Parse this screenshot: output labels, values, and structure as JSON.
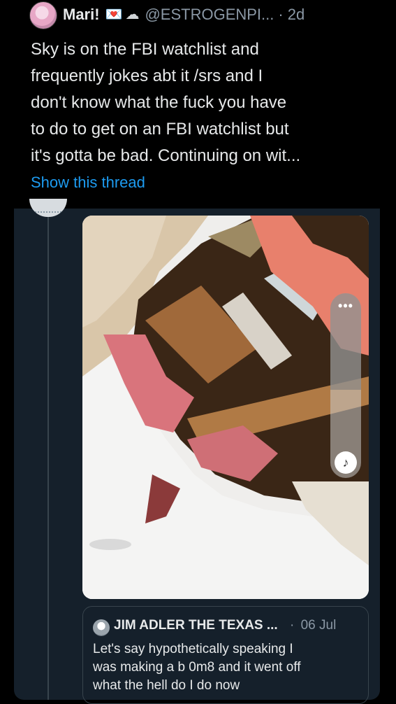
{
  "tweet": {
    "author_name": "Mari!",
    "emoji_1": "💌",
    "emoji_2": "☁",
    "handle": "@ESTROGENPI...",
    "separator": "·",
    "time": "2d",
    "text": "Sky is on the FBI watchlist and\nfrequently jokes abt it /srs and I\ndon't know what the fuck you have\nto do to get on an FBI watchlist but\nit's gotta be bad. Continuing on wit...",
    "show_thread": "Show this thread"
  },
  "media": {
    "more_label": "•••",
    "music_icon": "♪"
  },
  "quote": {
    "author_name": "JIM ADLER THE TEXAS ...",
    "separator": "·",
    "time": "06 Jul",
    "text": "Let's say hypothetically speaking I\nwas making a b 0m8 and it went off\nwhat the hell do I do now"
  },
  "colors": {
    "background": "#000000",
    "card_background": "#15202b",
    "link": "#1d9bf0",
    "secondary_text": "#8b98a5",
    "border": "#38444d"
  }
}
